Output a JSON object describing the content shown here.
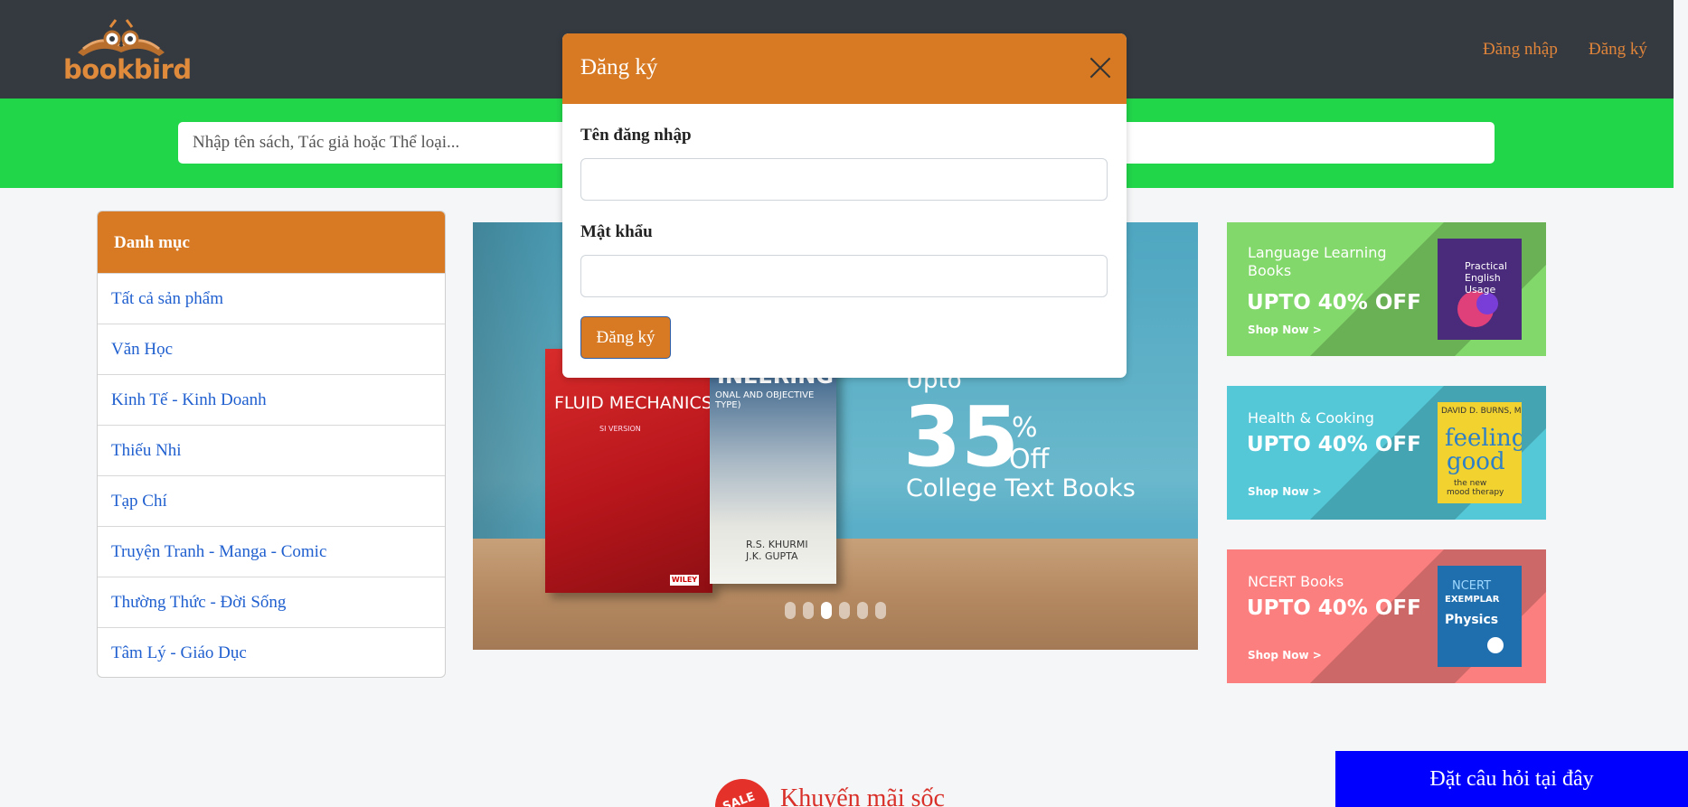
{
  "header": {
    "logo_text": "bookbird",
    "nav": {
      "login": "Đăng nhập",
      "register": "Đăng ký"
    }
  },
  "search": {
    "placeholder": "Nhập tên sách, Tác giả hoặc Thể loại..."
  },
  "sidebar": {
    "title": "Danh mục",
    "items": [
      {
        "label": "Tất cả sản phẩm"
      },
      {
        "label": "Văn Học"
      },
      {
        "label": "Kinh Tế - Kinh Doanh"
      },
      {
        "label": "Thiếu Nhi"
      },
      {
        "label": "Tạp Chí"
      },
      {
        "label": "Truyện Tranh - Manga - Comic"
      },
      {
        "label": "Thường Thức - Đời Sống"
      },
      {
        "label": "Tâm Lý - Giáo Dục"
      }
    ]
  },
  "carousel": {
    "upto": "Upto",
    "percent": "35",
    "percent_sign": "%",
    "off": "Off",
    "caption": "College Text Books",
    "book1_title": "FLUID MECHANICS",
    "book1_sub": "SI VERSION",
    "book1_publisher": "WILEY",
    "book2_title": "INEERING",
    "book2_sub": "ONAL AND OBJECTIVE TYPE)",
    "book2_authors": "R.S. KHURMI\nJ.K. GUPTA",
    "slide_count": 6,
    "active_slide": 3
  },
  "promos": [
    {
      "title": "Language Learning Books",
      "offer": "UPTO 40% OFF",
      "cta": "Shop Now >",
      "bg": "#82d86a",
      "book_title": "Practical English Usage",
      "book_color": "#4a2a7a"
    },
    {
      "title": "Health & Cooking",
      "offer": "UPTO 40% OFF",
      "cta": "Shop Now >",
      "bg": "#55c8d8",
      "book_title": "feeling good",
      "book_color": "#f2d22e"
    },
    {
      "title": "NCERT Books",
      "offer": "UPTO 40% OFF",
      "cta": "Shop Now >",
      "bg": "#fb7f7f",
      "book_title": "Physics",
      "book_color": "#1f6fae"
    }
  ],
  "section": {
    "badge": "SALE",
    "title": "Khuyến mãi sốc"
  },
  "chat": {
    "label": "Đặt câu hỏi tại đây"
  },
  "modal": {
    "title": "Đăng ký",
    "username_label": "Tên đăng nhập",
    "username_value": "",
    "password_label": "Mật khẩu",
    "password_value": "",
    "submit_label": "Đăng ký"
  },
  "colors": {
    "accent": "#d77a23",
    "search_band": "#22d64a",
    "header": "#343a40",
    "link": "#1f5fcf",
    "chat": "#0000ff"
  }
}
